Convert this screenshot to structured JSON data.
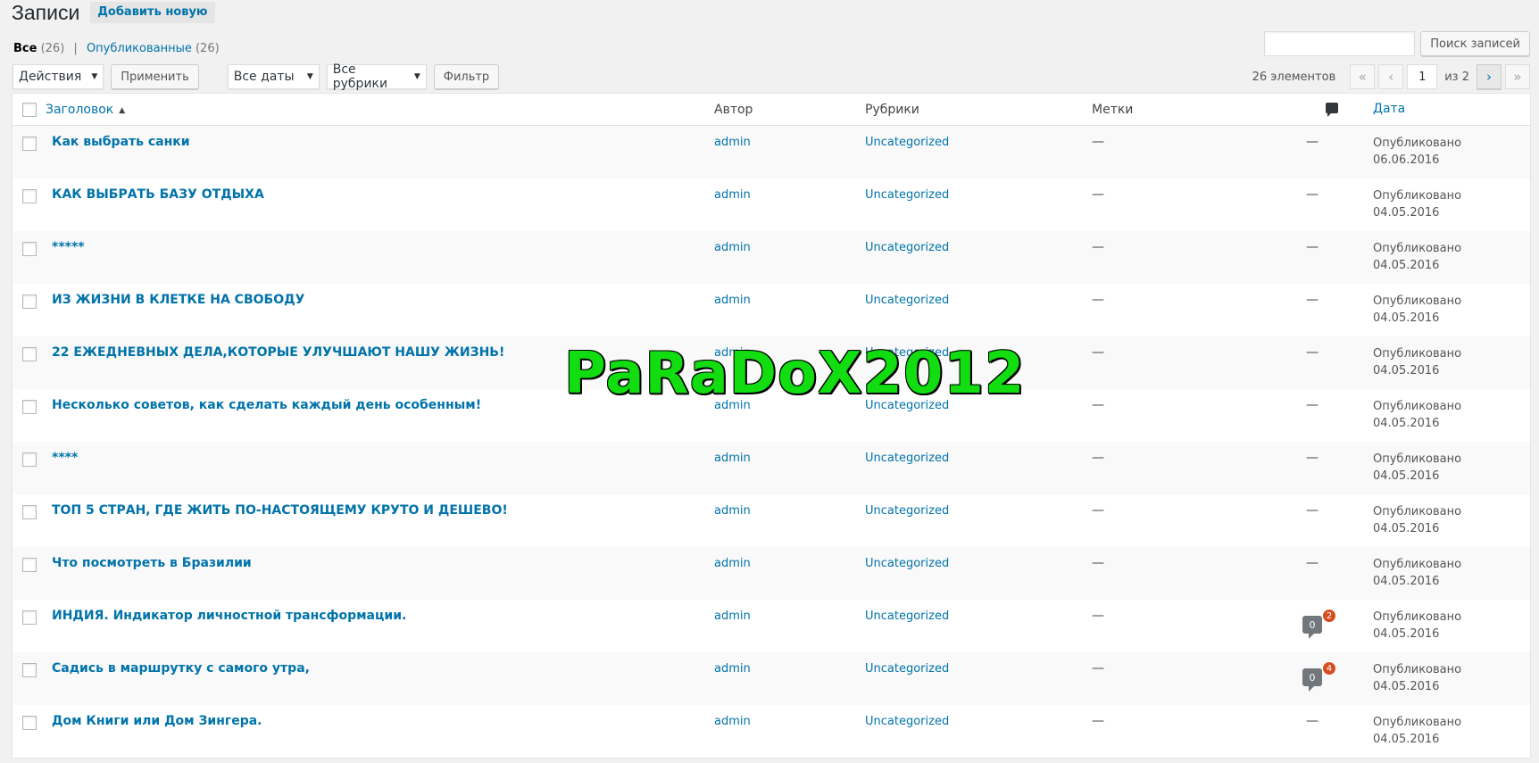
{
  "header": {
    "title": "Записи",
    "add_new": "Добавить новую"
  },
  "views": {
    "all_label": "Все",
    "all_count": "(26)",
    "separator": "|",
    "published_label": "Опубликованные",
    "published_count": "(26)"
  },
  "search": {
    "button": "Поиск записей",
    "value": ""
  },
  "filters": {
    "bulk_actions": "Действия",
    "apply": "Применить",
    "dates": "Все даты",
    "categories": "Все рубрики",
    "filter": "Фильтр"
  },
  "pagination": {
    "items": "26 элементов",
    "first": "«",
    "prev": "‹",
    "current": "1",
    "of": "из 2",
    "next": "›",
    "last": "»"
  },
  "columns": {
    "title": "Заголовок",
    "author": "Автор",
    "categories": "Рубрики",
    "tags": "Метки",
    "date": "Дата"
  },
  "rows": [
    {
      "title": "Как выбрать санки",
      "author": "admin",
      "category": "Uncategorized",
      "tags": "—",
      "comments": "—",
      "status": "Опубликовано",
      "date": "06.06.2016"
    },
    {
      "title": "КАК ВЫБРАТЬ БАЗУ ОТДЫХА",
      "author": "admin",
      "category": "Uncategorized",
      "tags": "—",
      "comments": "—",
      "status": "Опубликовано",
      "date": "04.05.2016"
    },
    {
      "title": "*****",
      "author": "admin",
      "category": "Uncategorized",
      "tags": "—",
      "comments": "—",
      "status": "Опубликовано",
      "date": "04.05.2016"
    },
    {
      "title": "ИЗ ЖИЗНИ В КЛЕТКЕ НА СВОБОДУ",
      "author": "admin",
      "category": "Uncategorized",
      "tags": "—",
      "comments": "—",
      "status": "Опубликовано",
      "date": "04.05.2016"
    },
    {
      "title": "22 ЕЖЕДНЕВНЫХ ДЕЛА,КОТОРЫЕ УЛУЧШАЮТ НАШУ ЖИЗНЬ!",
      "author": "admin",
      "category": "Uncategorized",
      "tags": "—",
      "comments": "—",
      "status": "Опубликовано",
      "date": "04.05.2016"
    },
    {
      "title": "Несколько советов, как сделать каждый день особенным!",
      "author": "admin",
      "category": "Uncategorized",
      "tags": "—",
      "comments": "—",
      "status": "Опубликовано",
      "date": "04.05.2016"
    },
    {
      "title": "****",
      "author": "admin",
      "category": "Uncategorized",
      "tags": "—",
      "comments": "—",
      "status": "Опубликовано",
      "date": "04.05.2016"
    },
    {
      "title": "ТОП 5 СТРАН, ГДЕ ЖИТЬ ПО-НАСТОЯЩЕМУ КРУТО И ДЕШЕВО!",
      "author": "admin",
      "category": "Uncategorized",
      "tags": "—",
      "comments": "—",
      "status": "Опубликовано",
      "date": "04.05.2016"
    },
    {
      "title": "Что посмотреть в Бразилии",
      "author": "admin",
      "category": "Uncategorized",
      "tags": "—",
      "comments": "—",
      "status": "Опубликовано",
      "date": "04.05.2016"
    },
    {
      "title": "ИНДИЯ. Индикатор личностной трансформации.",
      "author": "admin",
      "category": "Uncategorized",
      "tags": "—",
      "comments_approved": "0",
      "comments_pending": "2",
      "status": "Опубликовано",
      "date": "04.05.2016"
    },
    {
      "title": "Садись в маршрутку с самого утра,",
      "author": "admin",
      "category": "Uncategorized",
      "tags": "—",
      "comments_approved": "0",
      "comments_pending": "4",
      "status": "Опубликовано",
      "date": "04.05.2016"
    },
    {
      "title": "Дом Книги или Дом Зингера.",
      "author": "admin",
      "category": "Uncategorized",
      "tags": "—",
      "comments": "—",
      "status": "Опубликовано",
      "date": "04.05.2016"
    }
  ],
  "watermark": "PaRaDoX2012",
  "colors": {
    "link": "#0073aa",
    "pending": "#d54e21",
    "watermark": "#11dd11"
  }
}
